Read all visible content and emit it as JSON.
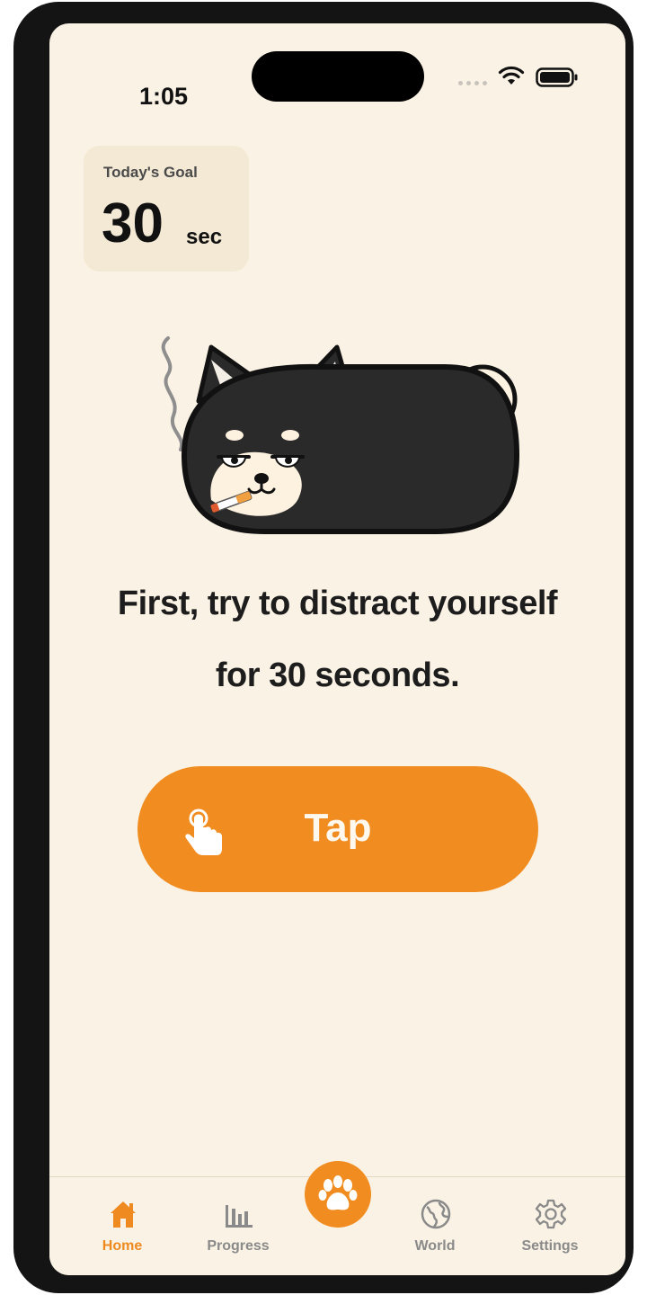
{
  "status_bar": {
    "time": "1:05"
  },
  "goal": {
    "label": "Today's Goal",
    "value": "30",
    "unit": "sec"
  },
  "message": {
    "line1": "First, try to distract yourself",
    "line2": "for 30 seconds."
  },
  "tap_button": {
    "label": "Tap",
    "icon": "pointing-hand-icon"
  },
  "tabbar": {
    "items": [
      {
        "label": "Home",
        "icon": "home-icon",
        "active": true
      },
      {
        "label": "Progress",
        "icon": "bar-chart-icon",
        "active": false
      },
      {
        "label": "World",
        "icon": "globe-icon",
        "active": false
      },
      {
        "label": "Settings",
        "icon": "gear-icon",
        "active": false
      }
    ],
    "center_icon": "paw-icon"
  },
  "colors": {
    "accent": "#f08c20",
    "background": "#faf2e4",
    "card": "#f4e9d4",
    "text": "#1d1d1d",
    "inactive_tab": "#8a8a8a"
  }
}
